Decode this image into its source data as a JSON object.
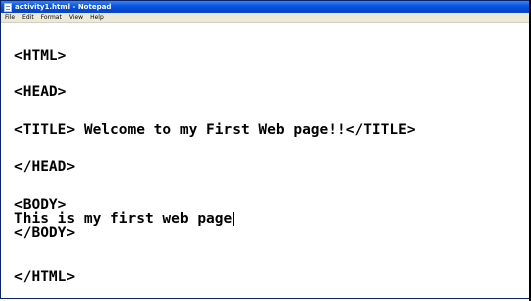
{
  "window": {
    "title": "activity1.html - Notepad",
    "icon": "notepad-icon"
  },
  "menu": {
    "items": [
      "File",
      "Edit",
      "Format",
      "View",
      "Help"
    ]
  },
  "document": {
    "lines": [
      "<HTML>",
      "<HEAD>",
      "<TITLE> Welcome to my First Web page!!</TITLE>",
      "</HEAD>",
      "<BODY>",
      "This is my first web page",
      "</BODY>",
      "</HTML>"
    ]
  },
  "colors": {
    "titlebar": "#0a58e0",
    "menubar": "#ece9d8",
    "text": "#000000"
  }
}
